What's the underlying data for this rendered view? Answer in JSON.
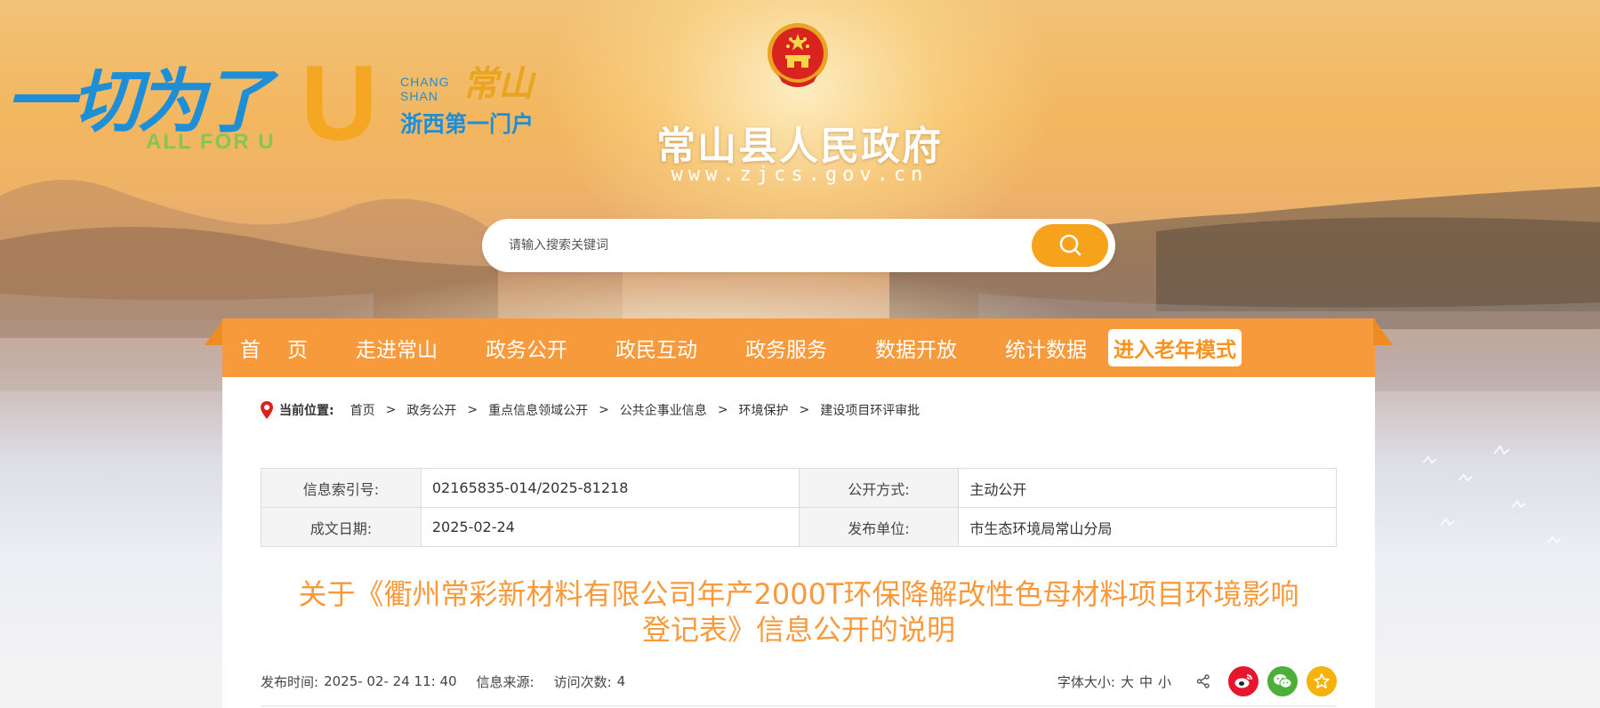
{
  "header": {
    "slogan": "一切为了",
    "slogan_u": "U",
    "slogan_en": "ALL FOR U",
    "changshan_en": "CHANG\nSHAN",
    "changshan_script": "常山",
    "gate_text": "浙西第一门户",
    "site_title": "常山县人民政府",
    "site_url": "www.zjcs.gov.cn"
  },
  "search": {
    "placeholder": "请输入搜索关键词",
    "button_icon": "search-icon"
  },
  "nav": {
    "items": [
      "首页",
      "走进常山",
      "政务公开",
      "政民互动",
      "政务服务",
      "数据开放",
      "统计数据"
    ],
    "elder_mode": "进入老年模式"
  },
  "breadcrumb": {
    "label": "当前位置:",
    "items": [
      "首页",
      "政务公开",
      "重点信息领域公开",
      "公共企事业信息",
      "环境保护",
      "建设项目环评审批"
    ],
    "separator": ">"
  },
  "meta": {
    "index_label": "信息索引号:",
    "index_value": "02165835-014/2025-81218",
    "method_label": "公开方式:",
    "method_value": "主动公开",
    "date_label": "成文日期:",
    "date_value": "2025-02-24",
    "unit_label": "发布单位:",
    "unit_value": "市生态环境局常山分局"
  },
  "article": {
    "title_line1": "关于《衢州常彩新材料有限公司年产2000T环保降解改性色母材料项目环境影响",
    "title_line2": "登记表》信息公开的说明"
  },
  "info": {
    "publish_label": "发布时间:",
    "publish_value": "2025- 02- 24 11: 40",
    "source_label": "信息来源:",
    "visits_label": "访问次数:",
    "visits_value": "4",
    "font_size_label": "字体大小:",
    "font_large": "大",
    "font_medium": "中",
    "font_small": "小"
  },
  "colors": {
    "nav_bg": "#f79a3c",
    "title": "#f79a3c",
    "search_btn": "#f7a21b",
    "weibo": "#e6162d",
    "wechat": "#4caf3a",
    "favorite": "#f5b30a"
  }
}
